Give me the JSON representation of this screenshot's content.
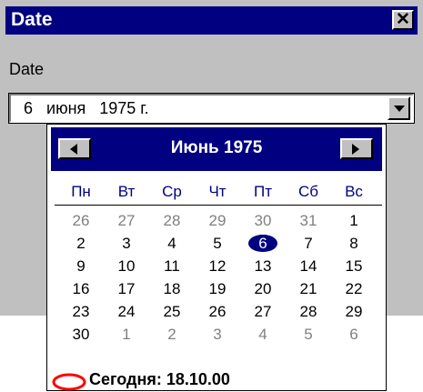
{
  "window": {
    "title": "Date",
    "field_label": "Date",
    "date_value": "6   июня   1975 г.",
    "close_icon": "close-x-icon",
    "dropdown_icon": "triangle-down-icon",
    "colors": {
      "titlebar": "#000080",
      "face": "#c0c0c0"
    }
  },
  "calendar": {
    "month_title": "Июнь 1975",
    "weekdays": [
      "Пн",
      "Вт",
      "Ср",
      "Чт",
      "Пт",
      "Сб",
      "Вс"
    ],
    "weeks": [
      [
        {
          "d": "26",
          "other": true
        },
        {
          "d": "27",
          "other": true
        },
        {
          "d": "28",
          "other": true
        },
        {
          "d": "29",
          "other": true
        },
        {
          "d": "30",
          "other": true
        },
        {
          "d": "31",
          "other": true
        },
        {
          "d": "1"
        }
      ],
      [
        {
          "d": "2"
        },
        {
          "d": "3"
        },
        {
          "d": "4"
        },
        {
          "d": "5"
        },
        {
          "d": "6",
          "selected": true
        },
        {
          "d": "7"
        },
        {
          "d": "8"
        }
      ],
      [
        {
          "d": "9"
        },
        {
          "d": "10"
        },
        {
          "d": "11"
        },
        {
          "d": "12"
        },
        {
          "d": "13"
        },
        {
          "d": "14"
        },
        {
          "d": "15"
        }
      ],
      [
        {
          "d": "16"
        },
        {
          "d": "17"
        },
        {
          "d": "18"
        },
        {
          "d": "19"
        },
        {
          "d": "20"
        },
        {
          "d": "21"
        },
        {
          "d": "22"
        }
      ],
      [
        {
          "d": "23"
        },
        {
          "d": "24"
        },
        {
          "d": "25"
        },
        {
          "d": "26"
        },
        {
          "d": "27"
        },
        {
          "d": "28"
        },
        {
          "d": "29"
        }
      ],
      [
        {
          "d": "30"
        },
        {
          "d": "1",
          "other": true
        },
        {
          "d": "2",
          "other": true
        },
        {
          "d": "3",
          "other": true
        },
        {
          "d": "4",
          "other": true
        },
        {
          "d": "5",
          "other": true
        },
        {
          "d": "6",
          "other": true
        }
      ]
    ],
    "today_label": "Сегодня: 18.10.00",
    "prev_icon": "triangle-left-icon",
    "next_icon": "triangle-right-icon",
    "colors": {
      "header": "#000080",
      "selected": "#000080",
      "today_circle": "#ff0000",
      "other_month": "#808080"
    }
  }
}
